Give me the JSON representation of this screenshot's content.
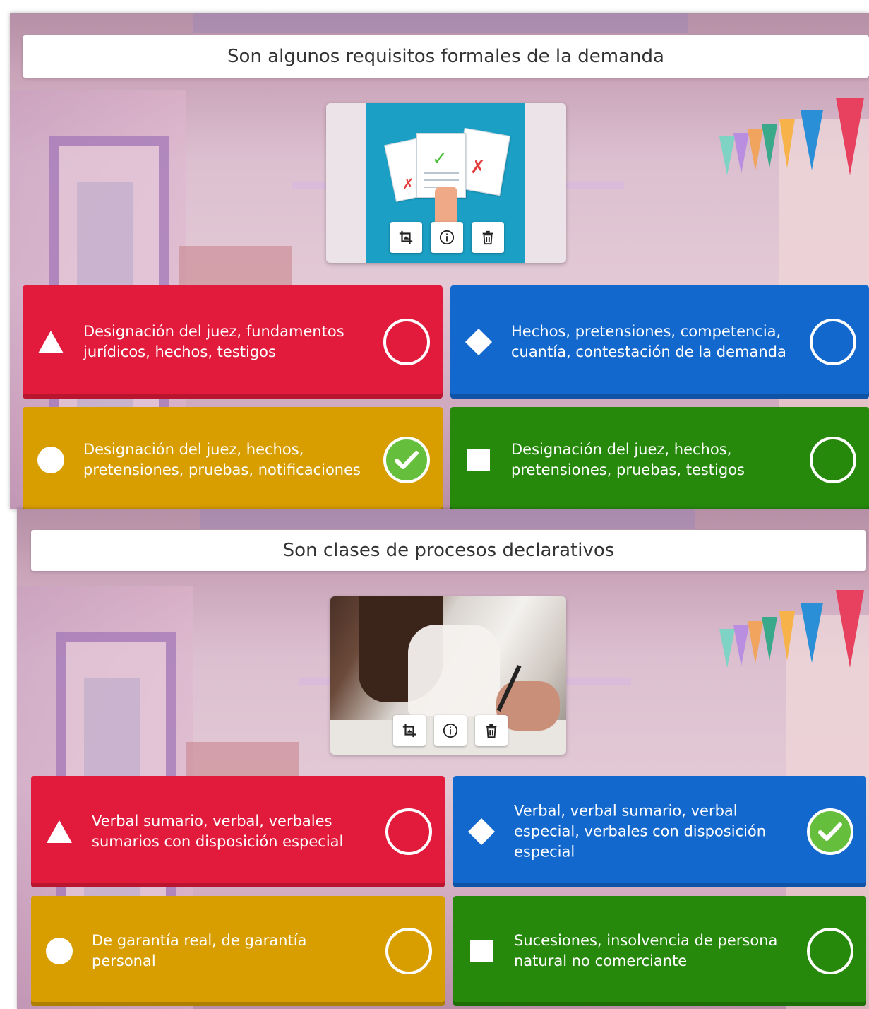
{
  "slides": [
    {
      "question": "Son algunos requisitos formales de la demanda",
      "media": {
        "kind": "illustration",
        "alt_icon": "documents-checklist-illustration"
      },
      "tools": [
        {
          "name": "crop-icon",
          "label": "crop"
        },
        {
          "name": "info-icon",
          "label": "info"
        },
        {
          "name": "trash-icon",
          "label": "delete"
        }
      ],
      "answers": [
        {
          "color": "red",
          "shape": "triangle",
          "text": "Designación del juez, fundamentos jurídicos, hechos, testigos",
          "correct": false
        },
        {
          "color": "blue",
          "shape": "diamond",
          "text": "Hechos, pretensiones, competencia, cuantía, contestación de la demanda",
          "correct": false
        },
        {
          "color": "yellow",
          "shape": "circle",
          "text": "Designación del juez, hechos, pretensiones, pruebas, notificaciones",
          "correct": true
        },
        {
          "color": "green",
          "shape": "square",
          "text": "Designación del juez, hechos, pretensiones, pruebas, testigos",
          "correct": false
        }
      ]
    },
    {
      "question": "Son clases de procesos declarativos",
      "media": {
        "kind": "photo",
        "alt_icon": "signing-document-photo"
      },
      "tools": [
        {
          "name": "crop-icon",
          "label": "crop"
        },
        {
          "name": "info-icon",
          "label": "info"
        },
        {
          "name": "trash-icon",
          "label": "delete"
        }
      ],
      "answers": [
        {
          "color": "red",
          "shape": "triangle",
          "text": "Verbal sumario, verbal, verbales sumarios con disposición especial",
          "correct": false
        },
        {
          "color": "blue",
          "shape": "diamond",
          "text": "Verbal, verbal sumario, verbal especial, verbales con disposición especial",
          "correct": true
        },
        {
          "color": "yellow",
          "shape": "circle",
          "text": "De garantía real, de garantía personal",
          "correct": false
        },
        {
          "color": "green",
          "shape": "square",
          "text": "Sucesiones, insolvencia de persona natural no comerciante",
          "correct": false
        }
      ]
    }
  ],
  "colors": {
    "red": "#e21b3c",
    "blue": "#1368ce",
    "yellow": "#d89e00",
    "green": "#26890c",
    "correct": "#66bf3c"
  }
}
